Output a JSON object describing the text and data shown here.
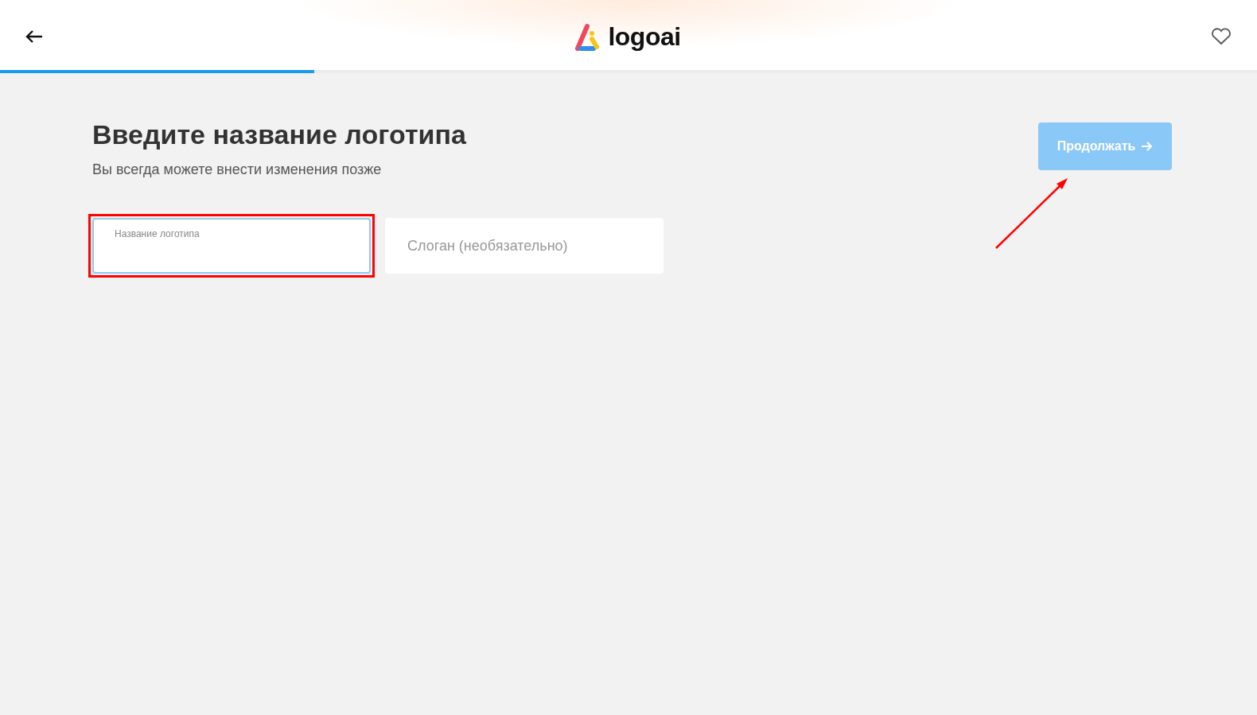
{
  "header": {
    "logo_text": "logoai",
    "progress": {
      "level": 0.25
    }
  },
  "title": "Введите название логотипа",
  "subtitle": "Вы всегда можете внести изменения позже",
  "fields": [
    {
      "label": "Название логотипа",
      "focused": true,
      "highlighted": true
    },
    {
      "placeholder": "Слоган (необязательно)",
      "focused": false,
      "highlighted": false
    }
  ],
  "continue_button": {
    "label": "Продолжать",
    "disabled": true,
    "annotated": true
  }
}
